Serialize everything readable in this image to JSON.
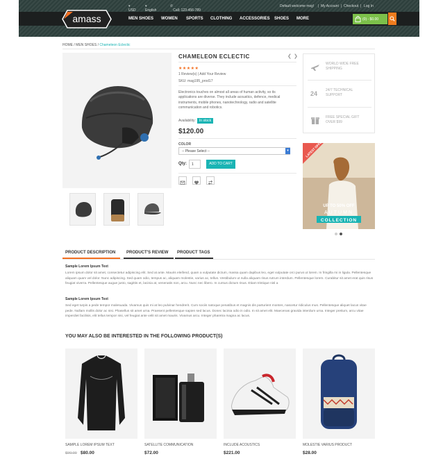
{
  "topbar": {
    "currency": "USD",
    "language": "English",
    "phone": "Call: 123-456-789",
    "welcome": "Default welcome msg!",
    "my_account": "My Account",
    "checkout": "Checkout",
    "login": "Log In",
    "sep": "|"
  },
  "logo": {
    "text": "amass"
  },
  "nav": [
    "MEN SHOES",
    "WOMEN",
    "SPORTS",
    "CLOTHING",
    "ACCESSORIES",
    "SHOES",
    "MORE"
  ],
  "cart": {
    "label": "(0) - $0.00"
  },
  "breadcrumb": {
    "home": "HOME",
    "sep": " / ",
    "category": "MEN SHOES",
    "current": "Chameleon Eclectic"
  },
  "product": {
    "title": "CHAMELEON ECLECTIC",
    "stars": "★★★★★",
    "reviews": "1 Review(s)",
    "review_sep": "|",
    "add_review": "Add Your Review",
    "sku": "SKU: mag195_prod17",
    "description": "Electronics touches on almost all areas of human activity, so its applications are diverse. They include acoustics, defence, medical instruments, mobile phones, nanotechnology, radio and satellite communication and robotics.",
    "availability_label": "Availability:",
    "availability_value": "In stock",
    "price": "$120.00",
    "color_label": "COLOR",
    "color_placeholder": "-- Please Select --",
    "qty_label": "Qty:",
    "qty_value": "1",
    "add_to_cart": "ADD TO CART"
  },
  "services": [
    {
      "icon": "airplane-icon",
      "lines": [
        "WORLD WIDE FREE",
        "SHIPPING"
      ]
    },
    {
      "icon": "support-24-icon",
      "lines": [
        "24/7 TECHNICAL",
        "SUPPORT"
      ]
    },
    {
      "icon": "gift-icon",
      "lines": [
        "FREE SPECIAL GIFT",
        "OVER $99"
      ]
    }
  ],
  "banner": {
    "ribbon": "LATEST OFFER",
    "line1": "UP TO 50% OFF",
    "line2": "AUTUMN",
    "line3": "COLLECTION"
  },
  "tabs": [
    "PRODUCT DESCRIPTION",
    "PRODUCT'S REVIEW",
    "PRODUCT TAGS"
  ],
  "tab_content": {
    "heading1": "Sample Lorem Ipsum Text",
    "para1": "Lorem ipsum dolor sit amet, consectetur adipiscing elit. Sed at ante. Mauris eleifend, quam a vulputate dictum, massa quam dapibus leo, eget vulputate orci purus ut lorem. In fringilla mi in ligula. Pellentesque aliquam quam vel dolor. Nunc adipiscing. Sed quam odio, tempus ac, aliquam molestie, varius ac, tellus. Vestibulum ut nulla aliquam risus rutrum interdum. Pellentesque lorem. Curabitur sit amet erat quis risus feugiat viverra. Pellentesque augue justo, sagittis et, lacinia at, venenatis non, arcu. Nunc nec libero. In cursus dictum risus. Etiam tristique nisl a",
    "heading2": "Sample Lorem Ipsum Text",
    "para2": "Sed eget turpis a pede tempor malesuada. Vivamus quis mi at leo pulvinar hendrerit. Cum sociis natoque penatibus et magnis dis parturient montes, nascetur ridiculus mus. Pellentesque aliquet lacus vitae pede. Nullam mollis dolor ac nisi. Phasellus sit amet urna. Praesent pellentesque sapien sed lacus. Donec lacinia odio in odio. In sit amet elit. Maecenas gravida interdum urna. Integer pretium, arcu vitae imperdiet facilisis, elit tellus tempor nisi, vel feugiat ante velit sit amet mauris. Vivamus arcu. Integer pharetra magna ac lacus."
  },
  "related": {
    "title": "YOU MAY ALSO BE INTERESTED IN THE FOLLOWING PRODUCT(S)",
    "products": [
      {
        "name": "SAMPLE LOREM IPSUM TEXT",
        "old_price": "$90.00",
        "price": "$80.00",
        "icon": "shirt-icon"
      },
      {
        "name": "SATELLITE COMMUNICATION",
        "old_price": "",
        "price": "$72.00",
        "icon": "perfume-icon"
      },
      {
        "name": "INCLUDE ACOUSTICS",
        "old_price": "",
        "price": "$221.00",
        "icon": "sneaker-icon"
      },
      {
        "name": "MOLESTIE VARIUS PRODUCT",
        "old_price": "",
        "price": "$28.00",
        "icon": "backpack-icon"
      }
    ]
  },
  "colors": {
    "accent": "#1ab4b4",
    "orange": "#f37021",
    "cart_green": "#7cc04a",
    "nav_bg": "#1c1f1f"
  }
}
